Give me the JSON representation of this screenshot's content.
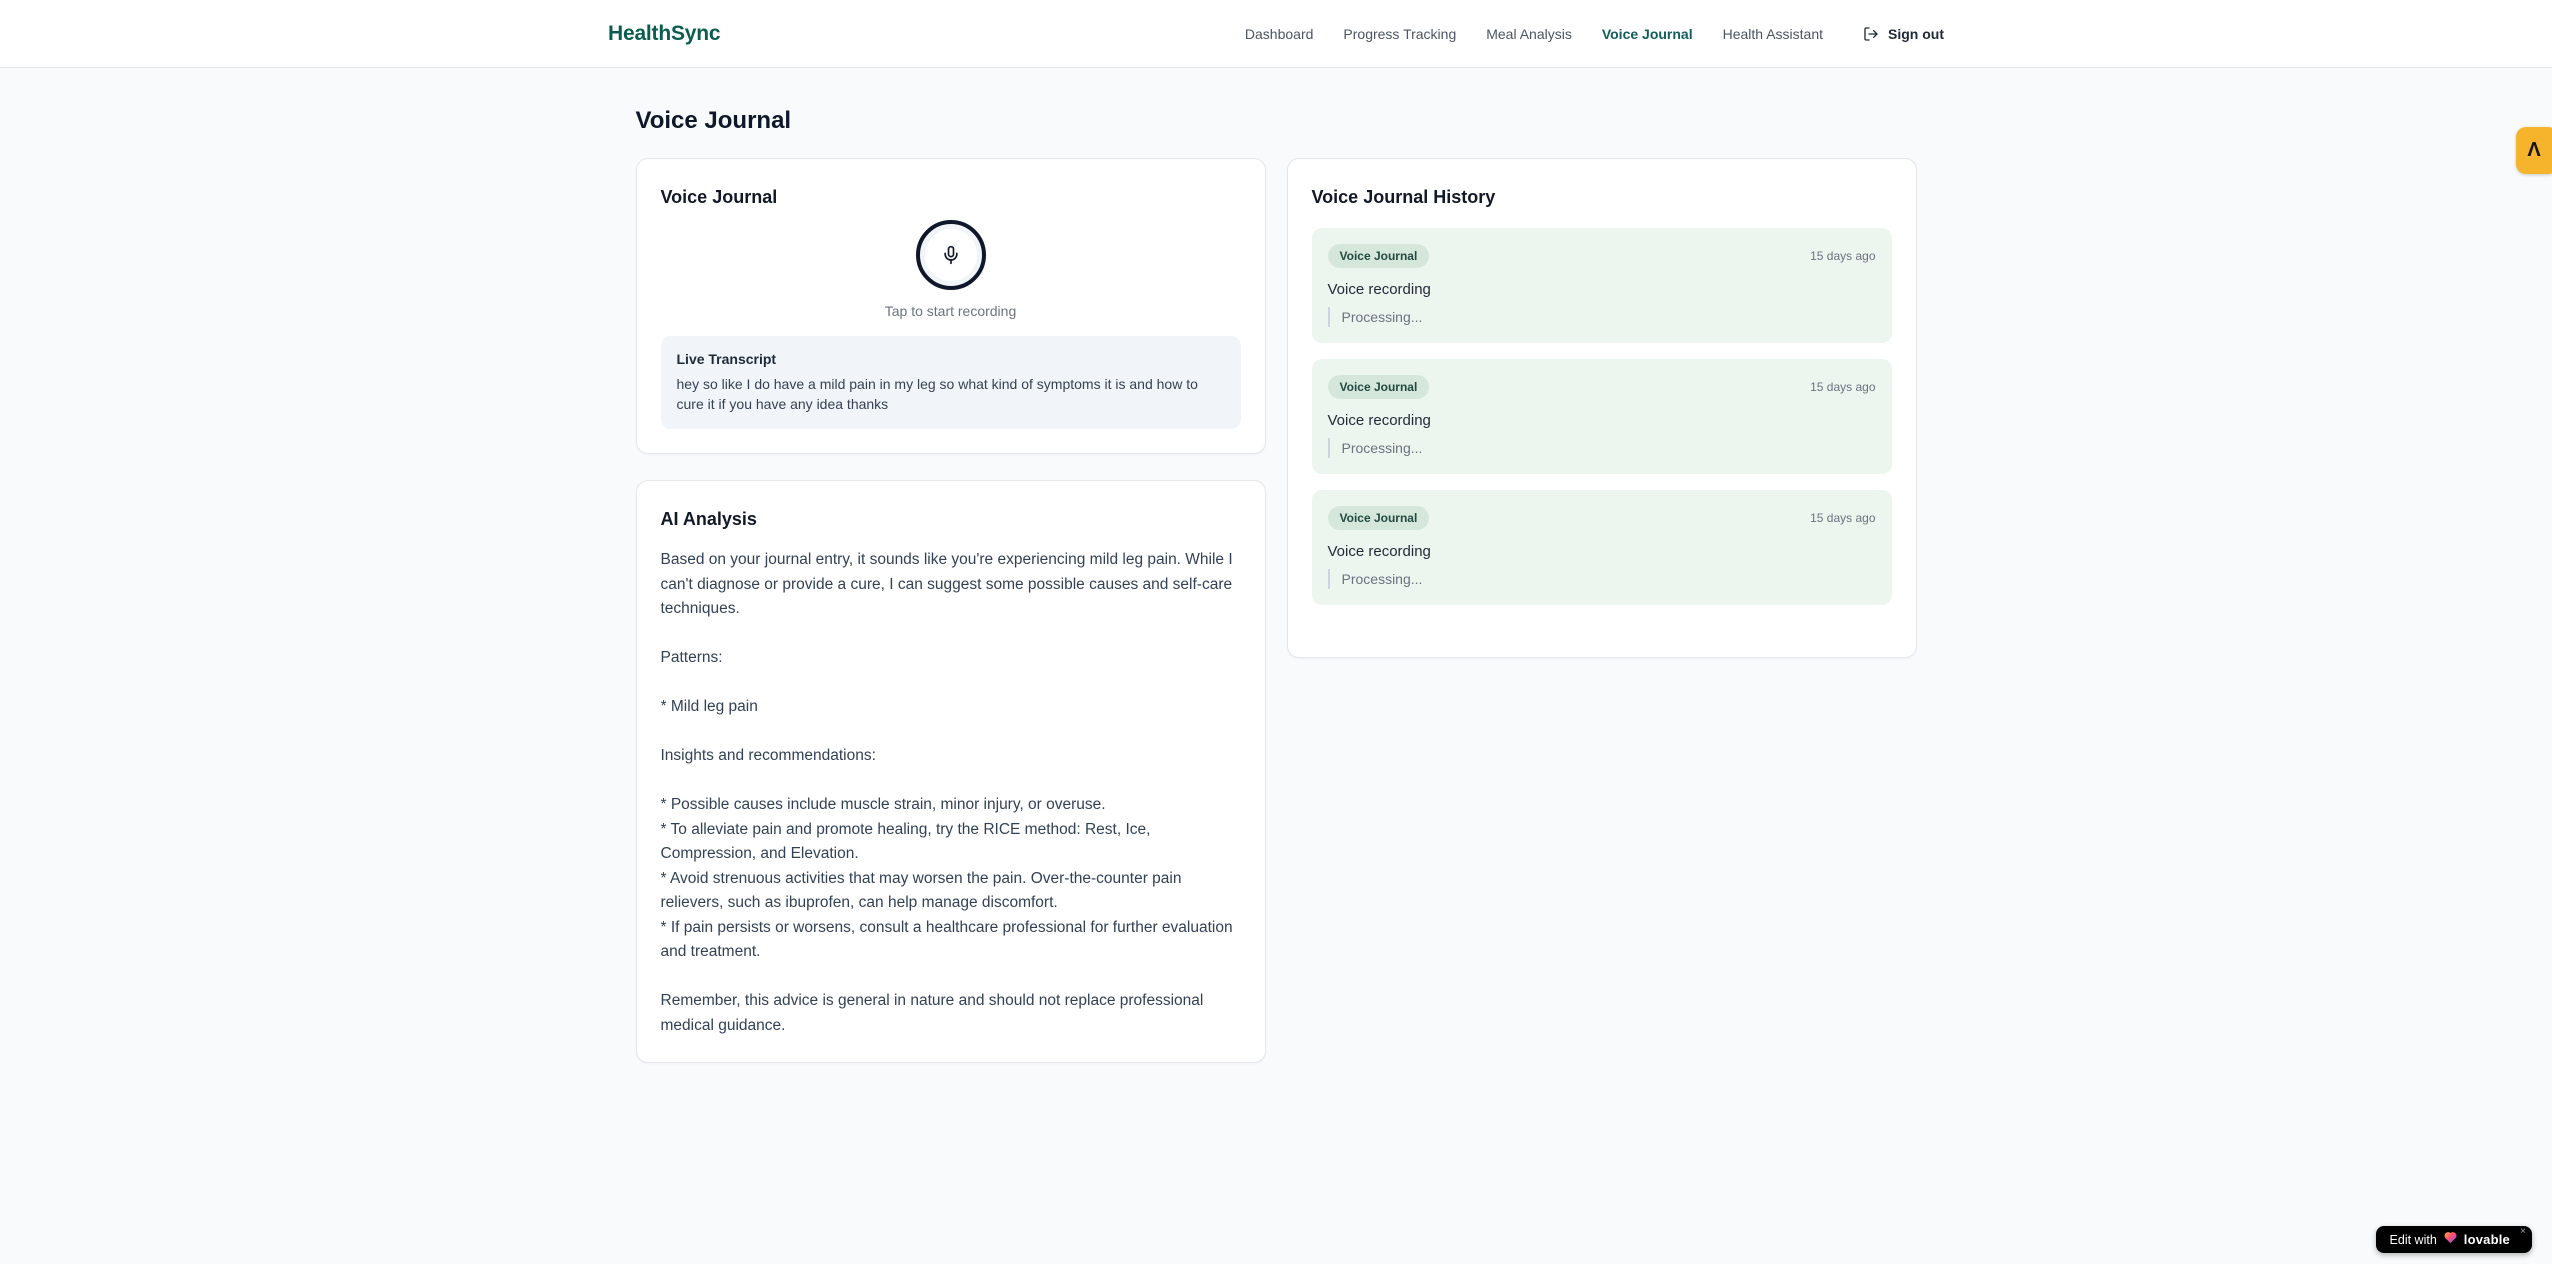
{
  "brand": {
    "name": "HealthSync"
  },
  "nav": {
    "items": [
      {
        "label": "Dashboard",
        "active": false
      },
      {
        "label": "Progress Tracking",
        "active": false
      },
      {
        "label": "Meal Analysis",
        "active": false
      },
      {
        "label": "Voice Journal",
        "active": true
      },
      {
        "label": "Health Assistant",
        "active": false
      }
    ],
    "sign_out_label": "Sign out",
    "sign_out_icon": "logout-icon"
  },
  "page": {
    "title": "Voice Journal"
  },
  "recorder_card": {
    "title": "Voice Journal",
    "mic_icon": "microphone-icon",
    "tap_hint": "Tap to start recording",
    "live_transcript": {
      "title": "Live Transcript",
      "text": "hey so like I do have a mild pain in my leg so what kind of symptoms it is and how to cure it if you have any idea thanks"
    }
  },
  "analysis_card": {
    "title": "AI Analysis",
    "text": "Based on your journal entry, it sounds like you're experiencing mild leg pain. While I can't diagnose or provide a cure, I can suggest some possible causes and self-care techniques.\n\nPatterns:\n\n* Mild leg pain\n\nInsights and recommendations:\n\n* Possible causes include muscle strain, minor injury, or overuse.\n* To alleviate pain and promote healing, try the RICE method: Rest, Ice, Compression, and Elevation.\n* Avoid strenuous activities that may worsen the pain. Over-the-counter pain relievers, such as ibuprofen, can help manage discomfort.\n* If pain persists or worsens, consult a healthcare professional for further evaluation and treatment.\n\nRemember, this advice is general in nature and should not replace professional medical guidance."
  },
  "history_card": {
    "title": "Voice Journal History",
    "items": [
      {
        "badge": "Voice Journal",
        "time": "15 days ago",
        "title": "Voice recording",
        "status": "Processing..."
      },
      {
        "badge": "Voice Journal",
        "time": "15 days ago",
        "title": "Voice recording",
        "status": "Processing..."
      },
      {
        "badge": "Voice Journal",
        "time": "15 days ago",
        "title": "Voice recording",
        "status": "Processing..."
      }
    ]
  },
  "widgets": {
    "side_badge": {
      "glyph": "Λ",
      "icon": "extension-logo-icon",
      "color": "#f6b42d"
    },
    "edit_badge": {
      "prefix": "Edit with",
      "brand": "lovable",
      "close": "×",
      "icon": "heart-gradient-icon"
    }
  },
  "colors": {
    "brand_teal": "#0b5d50",
    "active_nav": "#115e59",
    "page_bg": "#f8fafc",
    "card_border": "#e5e7eb",
    "history_item_bg": "#edf5ef",
    "history_badge_bg": "#d5e7da",
    "transcript_bg": "#f1f5f9",
    "muted_text": "#6b7280",
    "side_badge_bg": "#f6b42d"
  }
}
